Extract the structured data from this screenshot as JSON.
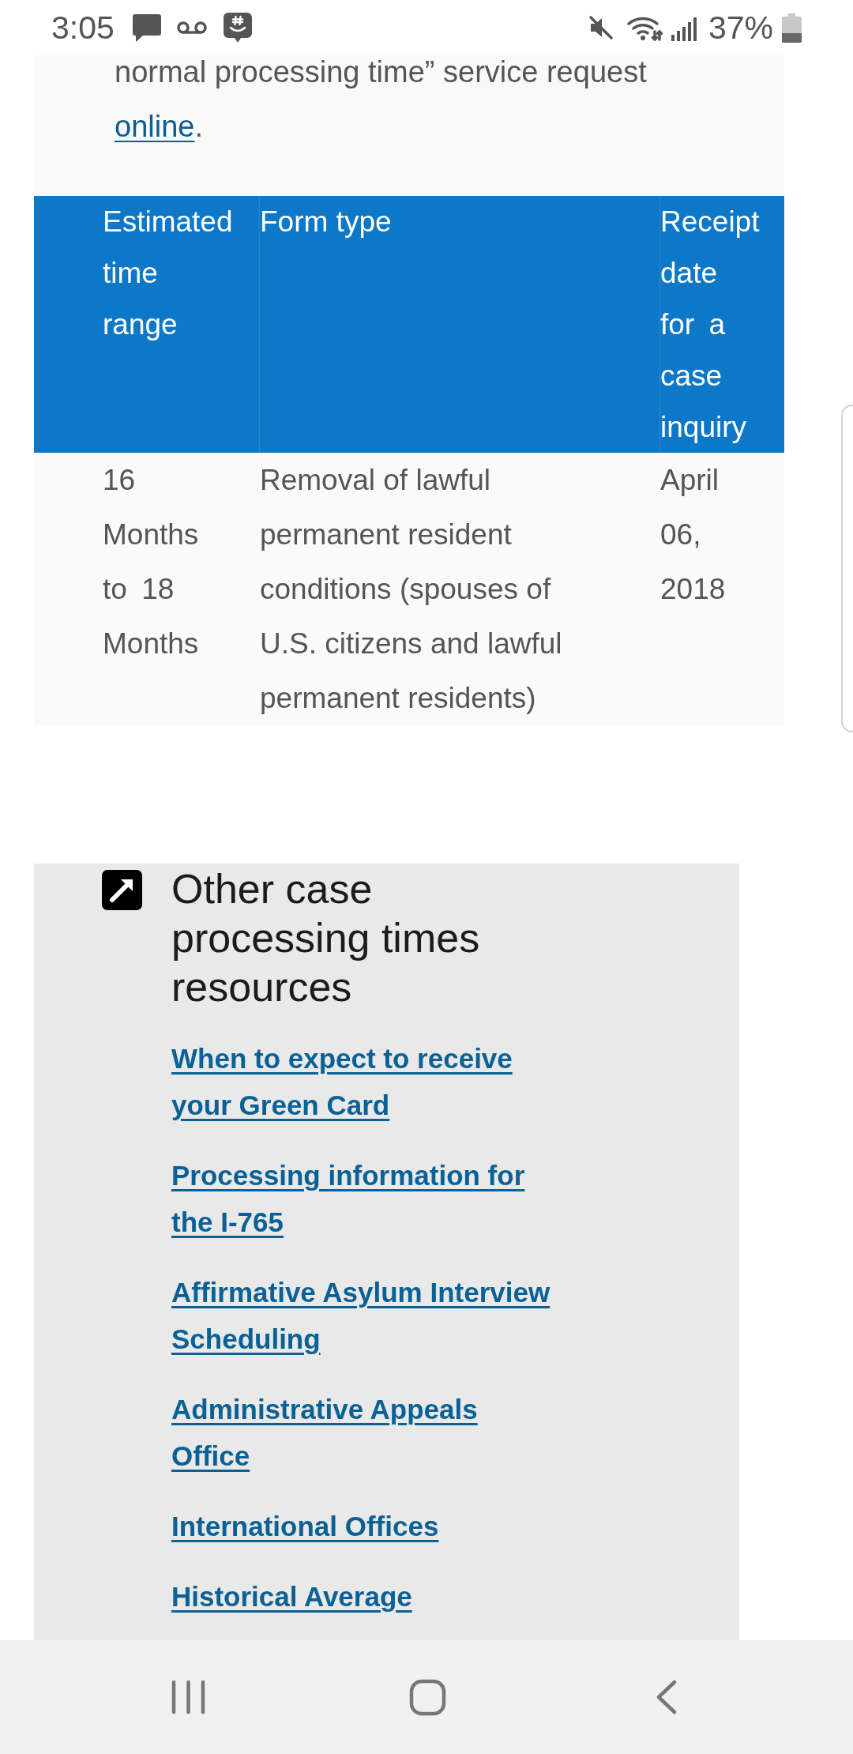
{
  "status_bar": {
    "time": "3:05",
    "battery": "37%"
  },
  "intro": {
    "text": "normal processing time” service request",
    "link": "online",
    "after": "."
  },
  "table": {
    "columns": [
      "Estimated time range",
      "Form type",
      "Receipt date for a case inquiry"
    ],
    "rows": [
      [
        "16 Months to 18 Months",
        "Removal of lawful permanent resident conditions (spouses of U.S. citizens and lawful permanent residents)",
        "April 06, 2018"
      ]
    ]
  },
  "resources": {
    "title": "Other case processing times resources",
    "links": [
      "When to expect to receive your Green Card",
      "Processing information for the I-765",
      "Affirmative Asylum Interview Scheduling",
      "Administrative Appeals Office",
      "International Offices",
      "Historical Average"
    ]
  }
}
